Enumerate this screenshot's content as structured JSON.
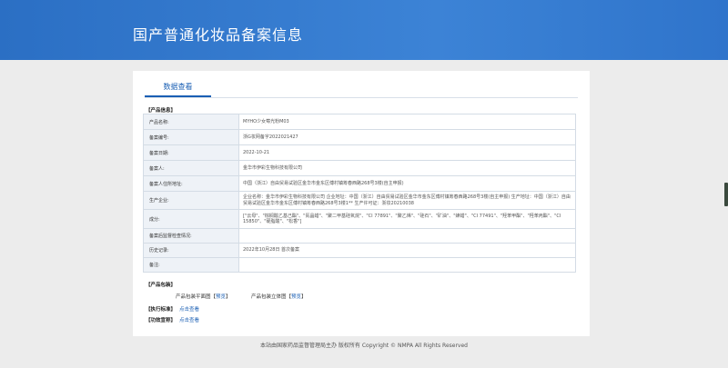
{
  "header": {
    "title": "国产普通化妆品备案信息"
  },
  "tab": {
    "label": "数据查看"
  },
  "product_info": {
    "section_label": "【产品信息】",
    "rows": [
      {
        "key": "产品名称:",
        "value": "MYHO少女莓光粉M03"
      },
      {
        "key": "备案编号:",
        "value": "浙G妆网备字2022021427"
      },
      {
        "key": "备案日期:",
        "value": "2022-10-21"
      },
      {
        "key": "备案人:",
        "value": "金华市伊彩生物科技有限公司"
      },
      {
        "key": "备案人住所地址:",
        "value": "中国（浙江）自由贸易试验区金华市金东区傅村镇筹春西路268号3楼(自主申报)"
      },
      {
        "key": "生产企业:",
        "value": "企业名称：金华市伊彩生物科技有限公司 企业地址：中国（浙江）自由贸易试验区金华市金东区傅村镇筹春西路268号3楼(自主申报) 生产地址：中国（浙江）自由贸易试验区金华市金东区傅村镇筹春西路268号3楼1** 生产许可证：浙妆20210038"
      },
      {
        "key": "成分:",
        "value": "[\"云母\"、\"棕榈酸乙基己酯\"、\"氮晶蜡\"、\"聚二甲基硅氧烷\"、\"CI 77891\"、\"聚乙烯\"、\"硅石\"、\"矿油\"、\"蜂蜡\"、\"CI 77491\"、\"羟苯甲酯\"、\"羟苯丙酯\"、\"CI 15850\"、\"硬脂酸\"、\"松香\"]"
      },
      {
        "key": "备案后监督检查情况:",
        "value": ""
      },
      {
        "key": "历史记录:",
        "value": "2022年10月28日 首次备案"
      },
      {
        "key": "备注:",
        "value": ""
      }
    ]
  },
  "package": {
    "section_label": "【产品包装】",
    "flat_label": "产品包装平面图【",
    "flat_link": "预览",
    "flat_end": "】",
    "solid_label": "产品包装立体图【",
    "solid_link": "预览",
    "solid_end": "】"
  },
  "standard": {
    "section_label": "【执行标准】",
    "link": "点击查看"
  },
  "efficacy": {
    "section_label": "【功效宣称】",
    "link": "点击查看"
  },
  "footer": {
    "text": "本站由国家药品监督管理局主办 版权所有 Copyright © NMPA All Rights Reserved"
  }
}
